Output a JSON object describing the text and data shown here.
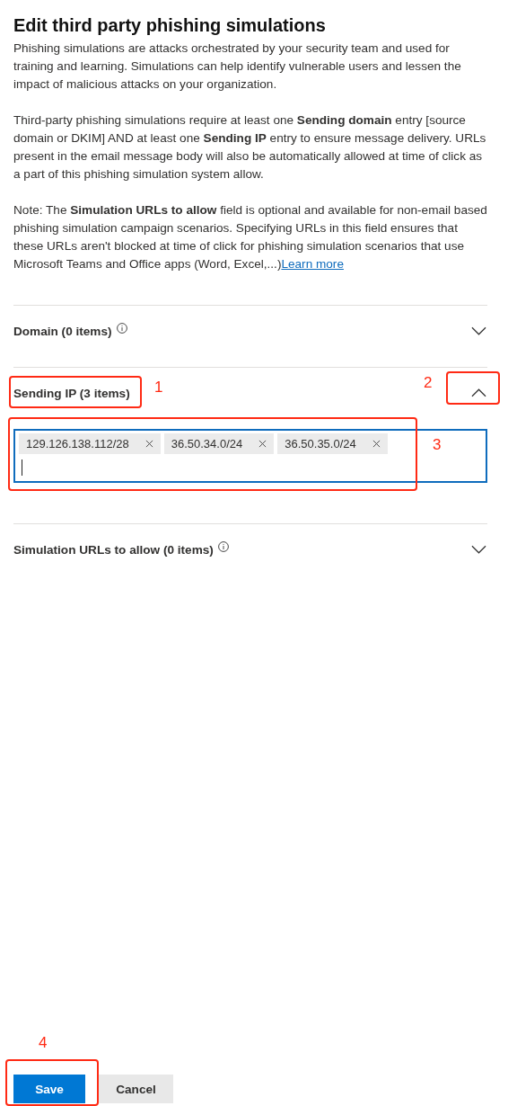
{
  "title": "Edit third party phishing simulations",
  "paragraphs": [
    {
      "text": "Phishing simulations are attacks orchestrated by your security team and used for training and learning. Simulations can help identify vulnerable users and lessen the impact of malicious attacks on your organization."
    },
    {
      "text": "Third-party phishing simulations require at least one **Sending domain** entry [source domain or DKIM] AND at least one **Sending IP** entry to ensure message delivery. URLs present in the email message body will also be automatically allowed at time of click as a part of this phishing simulation system allow."
    },
    {
      "text": "Note: The **Simulation URLs to allow** field is optional and available for non-email based phishing simulation campaign scenarios. Specifying URLs in this field ensures that these URLs aren't blocked at time of click for phishing simulation scenarios that use Microsoft Teams and Office apps (Word, Excel,...)",
      "link": "Learn more"
    }
  ],
  "sections": [
    {
      "label": "Domain (0 items)",
      "info_icon": true,
      "expanded": false
    },
    {
      "label": "Sending IP (3 items)",
      "info_icon": false,
      "expanded": true,
      "tags": [
        "129.126.138.112/28",
        "36.50.34.0/24",
        "36.50.35.0/24"
      ]
    },
    {
      "label": "Simulation URLs to allow (0 items)",
      "info_icon": true,
      "expanded": false
    }
  ],
  "buttons": [
    {
      "label": "Save",
      "kind": "primary"
    },
    {
      "label": "Cancel",
      "kind": "secondary"
    }
  ],
  "annotations": [
    {
      "number": "1"
    },
    {
      "number": "2"
    },
    {
      "number": "3"
    },
    {
      "number": "4"
    }
  ]
}
